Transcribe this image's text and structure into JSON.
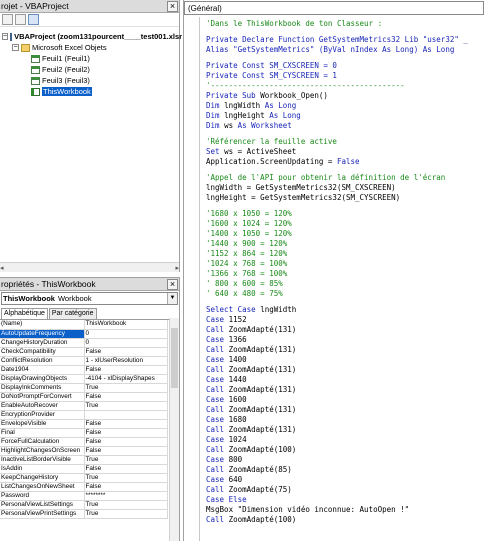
{
  "project": {
    "title": "rojet - VBAProject",
    "close_glyph": "×",
    "nodes": {
      "root": "VBAProject (zoom131pourcent____test001.xlsr",
      "objects_folder": "Microsoft Excel Objets",
      "sheet1": "Feuil1 (Feuil1)",
      "sheet2": "Feuil2 (Feuil2)",
      "sheet3": "Feuil3 (Feuil3)",
      "workbook": "ThisWorkbook"
    },
    "expander_minus": "−",
    "scroll_left": "◂",
    "scroll_right": "▸"
  },
  "properties": {
    "title": "ropriétés - ThisWorkbook",
    "close_glyph": "×",
    "object_name": "ThisWorkbook",
    "object_type": "Workbook",
    "dropdown_glyph": "▼",
    "tabs": {
      "alpha": "Alphabétique",
      "category": "Par catégorie"
    },
    "rows": [
      {
        "name": "(Name)",
        "value": "ThisWorkbook"
      },
      {
        "name": "AutoUpdateFrequency",
        "value": "0"
      },
      {
        "name": "ChangeHistoryDuration",
        "value": "0"
      },
      {
        "name": "CheckCompatibility",
        "value": "False"
      },
      {
        "name": "ConflictResolution",
        "value": "1 - xlUserResolution"
      },
      {
        "name": "Date1904",
        "value": "False"
      },
      {
        "name": "DisplayDrawingObjects",
        "value": "-4104 - xlDisplayShapes"
      },
      {
        "name": "DisplayInkComments",
        "value": "True"
      },
      {
        "name": "DoNotPromptForConvert",
        "value": "False"
      },
      {
        "name": "EnableAutoRecover",
        "value": "True"
      },
      {
        "name": "EncryptionProvider",
        "value": ""
      },
      {
        "name": "EnvelopeVisible",
        "value": "False"
      },
      {
        "name": "Final",
        "value": "False"
      },
      {
        "name": "ForceFullCalculation",
        "value": "False"
      },
      {
        "name": "HighlightChangesOnScreen",
        "value": "False"
      },
      {
        "name": "InactiveListBorderVisible",
        "value": "True"
      },
      {
        "name": "IsAddin",
        "value": "False"
      },
      {
        "name": "KeepChangeHistory",
        "value": "True"
      },
      {
        "name": "ListChangesOnNewSheet",
        "value": "False"
      },
      {
        "name": "Password",
        "value": "********"
      },
      {
        "name": "PersonalViewListSettings",
        "value": "True"
      },
      {
        "name": "PersonalViewPrintSettings",
        "value": "True"
      }
    ]
  },
  "code": {
    "object_combo": "(Général)",
    "lines": {
      "l01": "'Dans le ThisWorkbook de ton Classeur :",
      "l02a": "Private Declare Function ",
      "l02b": "GetSystemMetrics32 Lib \"user32\" _",
      "l03a": "Alias \"GetSystemMetrics\" (ByVal nIndex As Long) As Long",
      "l04a": "Private Const ",
      "l04b": "SM_CXSCREEN = 0",
      "l05a": "Private Const ",
      "l05b": "SM_CYSCREEN = 1",
      "l06": "'-------------------------------------------",
      "l07a": "Private Sub ",
      "l07b": "Workbook_Open()",
      "l08a": "Dim ",
      "l08b": "lngWidth ",
      "l08c": "As Long",
      "l09a": "Dim ",
      "l09b": "lngHeight ",
      "l09c": "As Long",
      "l10a": "Dim ",
      "l10b": "ws ",
      "l10c": "As Worksheet",
      "l11": "'Référencer la feuille active",
      "l12a": "Set ",
      "l12b": "ws = ActiveSheet",
      "l13a": "Application.ScreenUpdating = ",
      "l13b": "False",
      "l14": "'Appel de l'API pour obtenir la définition de l'écran",
      "l15": "lngWidth = GetSystemMetrics32(SM_CXSCREEN)",
      "l16": "lngHeight = GetSystemMetrics32(SM_CYSCREEN)",
      "c1": "'1680 x 1050 = 120%",
      "c2": "'1600 x 1024 = 120%",
      "c3": "'1400 x 1050 = 120%",
      "c4": "'1440 x 900 = 120%",
      "c5": "'1152 x 864 = 120%",
      "c6": "'1024 x 768 = 100%",
      "c7": "'1366 x 768 = 100%",
      "c8": "' 800 x 600 = 85%",
      "c9": "' 640 x 480 = 75%",
      "s1a": "Select Case ",
      "s1b": "lngWidth",
      "k_case": "Case ",
      "k_call": "Call ",
      "v1152": "1152",
      "v1366": "1366",
      "v1400": "1400",
      "v1440": "1440",
      "v1600": "1600",
      "v1680": "1680",
      "v1024": "1024",
      "v800": "800",
      "v640": "640",
      "z131": "ZoomAdapté(131)",
      "z100": "ZoomAdapté(100)",
      "z85": "ZoomAdapté(85)",
      "z75": "ZoomAdapté(75)",
      "case_else": "Case Else",
      "msg_a": "MsgBox ",
      "msg_b": "\"Dimension vidéo inconnue: AutoOpen !\""
    }
  }
}
